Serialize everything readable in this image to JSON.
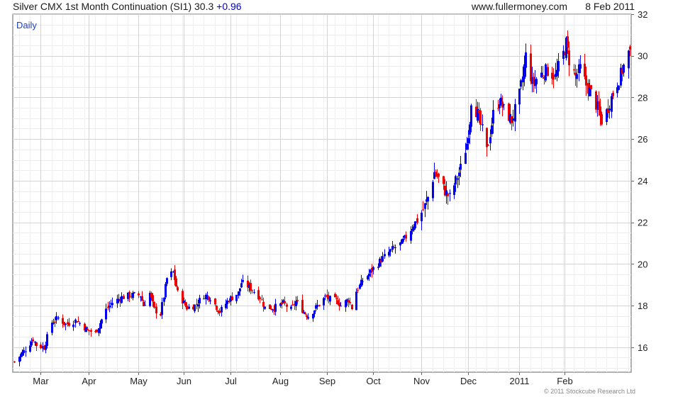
{
  "header": {
    "title": "Silver CMX 1st Month Continuation (SI1)",
    "last": "30.3",
    "change": "+0.96",
    "site": "www.fullermoney.com",
    "date": "8 Feb 2011"
  },
  "footer": {
    "copyright": "© 2011 Stockcube Research Ltd"
  },
  "colors": {
    "up": "#0000ee",
    "down": "#ee0000",
    "grid": "#d4d4d4",
    "frame": "#666666",
    "label": "#1f3fbf"
  },
  "chart_data": {
    "type": "candlestick",
    "interval_label": "Daily",
    "ylim": [
      14.8,
      32
    ],
    "yticks": [
      16,
      18,
      20,
      22,
      24,
      26,
      28,
      30,
      32
    ],
    "y_axis_side": "right",
    "grid": true,
    "xticks": [
      {
        "label": "Mar",
        "date": "2010-03-01"
      },
      {
        "label": "Apr",
        "date": "2010-04-01"
      },
      {
        "label": "May",
        "date": "2010-05-03"
      },
      {
        "label": "Jun",
        "date": "2010-06-01"
      },
      {
        "label": "Jul",
        "date": "2010-07-01"
      },
      {
        "label": "Aug",
        "date": "2010-08-02"
      },
      {
        "label": "Sep",
        "date": "2010-09-01"
      },
      {
        "label": "Oct",
        "date": "2010-10-01"
      },
      {
        "label": "Nov",
        "date": "2010-11-01"
      },
      {
        "label": "Dec",
        "date": "2010-12-01"
      },
      {
        "label": "2011",
        "date": "2011-01-03"
      },
      {
        "label": "Feb",
        "date": "2011-02-01"
      }
    ],
    "close_path": [
      [
        "2010-02-12",
        15.3
      ],
      [
        "2010-02-19",
        15.9
      ],
      [
        "2010-02-24",
        16.4
      ],
      [
        "2010-02-26",
        16.1
      ],
      [
        "2010-03-03",
        16.0
      ],
      [
        "2010-03-08",
        17.2
      ],
      [
        "2010-03-12",
        17.4
      ],
      [
        "2010-03-17",
        17.1
      ],
      [
        "2010-03-24",
        17.3
      ],
      [
        "2010-03-31",
        16.8
      ],
      [
        "2010-04-05",
        16.7
      ],
      [
        "2010-04-12",
        17.8
      ],
      [
        "2010-04-15",
        18.1
      ],
      [
        "2010-04-22",
        18.4
      ],
      [
        "2010-04-28",
        18.5
      ],
      [
        "2010-05-04",
        18.5
      ],
      [
        "2010-05-06",
        18.0
      ],
      [
        "2010-05-10",
        18.6
      ],
      [
        "2010-05-13",
        17.8
      ],
      [
        "2010-05-17",
        17.6
      ],
      [
        "2010-05-21",
        19.3
      ],
      [
        "2010-05-25",
        19.6
      ],
      [
        "2010-05-28",
        18.6
      ],
      [
        "2010-06-03",
        17.9
      ],
      [
        "2010-06-08",
        18.0
      ],
      [
        "2010-06-14",
        18.5
      ],
      [
        "2010-06-18",
        18.4
      ],
      [
        "2010-06-24",
        17.7
      ],
      [
        "2010-06-30",
        18.3
      ],
      [
        "2010-07-06",
        18.6
      ],
      [
        "2010-07-08",
        19.1
      ],
      [
        "2010-07-13",
        18.9
      ],
      [
        "2010-07-20",
        18.4
      ],
      [
        "2010-07-23",
        17.9
      ],
      [
        "2010-07-29",
        17.9
      ],
      [
        "2010-08-04",
        18.1
      ],
      [
        "2010-08-09",
        17.8
      ],
      [
        "2010-08-12",
        18.2
      ],
      [
        "2010-08-17",
        17.7
      ],
      [
        "2010-08-20",
        17.5
      ],
      [
        "2010-08-25",
        17.9
      ],
      [
        "2010-08-31",
        18.4
      ],
      [
        "2010-09-03",
        18.3
      ],
      [
        "2010-09-08",
        18.2
      ],
      [
        "2010-09-10",
        18.0
      ],
      [
        "2010-09-15",
        18.3
      ],
      [
        "2010-09-17",
        17.9
      ],
      [
        "2010-09-20",
        18.7
      ],
      [
        "2010-09-24",
        19.2
      ],
      [
        "2010-09-30",
        19.7
      ],
      [
        "2010-10-06",
        20.2
      ],
      [
        "2010-10-13",
        20.7
      ],
      [
        "2010-10-19",
        21.0
      ],
      [
        "2010-10-22",
        21.3
      ],
      [
        "2010-10-27",
        21.9
      ],
      [
        "2010-10-29",
        22.1
      ],
      [
        "2010-11-02",
        22.6
      ],
      [
        "2010-11-05",
        23.2
      ],
      [
        "2010-11-09",
        24.4
      ],
      [
        "2010-11-12",
        24.1
      ],
      [
        "2010-11-16",
        23.5
      ],
      [
        "2010-11-19",
        23.2
      ],
      [
        "2010-11-23",
        24.0
      ],
      [
        "2010-11-26",
        24.6
      ],
      [
        "2010-11-30",
        25.8
      ],
      [
        "2010-12-02",
        26.9
      ],
      [
        "2010-12-03",
        27.9
      ],
      [
        "2010-12-07",
        27.2
      ],
      [
        "2010-12-10",
        26.4
      ],
      [
        "2010-12-13",
        25.4
      ],
      [
        "2010-12-15",
        26.3
      ],
      [
        "2010-12-17",
        27.2
      ],
      [
        "2010-12-21",
        27.9
      ],
      [
        "2010-12-24",
        27.4
      ],
      [
        "2010-12-29",
        26.9
      ],
      [
        "2011-01-03",
        28.1
      ],
      [
        "2011-01-05",
        29.0
      ],
      [
        "2011-01-07",
        30.0
      ],
      [
        "2011-01-11",
        28.7
      ],
      [
        "2011-01-14",
        28.9
      ],
      [
        "2011-01-18",
        29.2
      ],
      [
        "2011-01-21",
        29.3
      ],
      [
        "2011-01-26",
        29.0
      ],
      [
        "2011-01-31",
        30.1
      ],
      [
        "2011-02-02",
        30.6
      ],
      [
        "2011-02-04",
        29.8
      ],
      [
        "2011-02-08",
        29.0
      ],
      [
        "2011-02-11",
        29.4
      ],
      [
        "2011-02-15",
        28.6
      ],
      [
        "2011-02-18",
        28.2
      ],
      [
        "2011-02-23",
        27.3
      ],
      [
        "2011-02-25",
        26.9
      ],
      [
        "2011-02-28",
        27.3
      ],
      [
        "2011-03-03",
        28.0
      ],
      [
        "2011-03-08",
        28.9
      ],
      [
        "2011-03-11",
        29.5
      ],
      [
        "2011-03-15",
        30.3
      ]
    ]
  }
}
